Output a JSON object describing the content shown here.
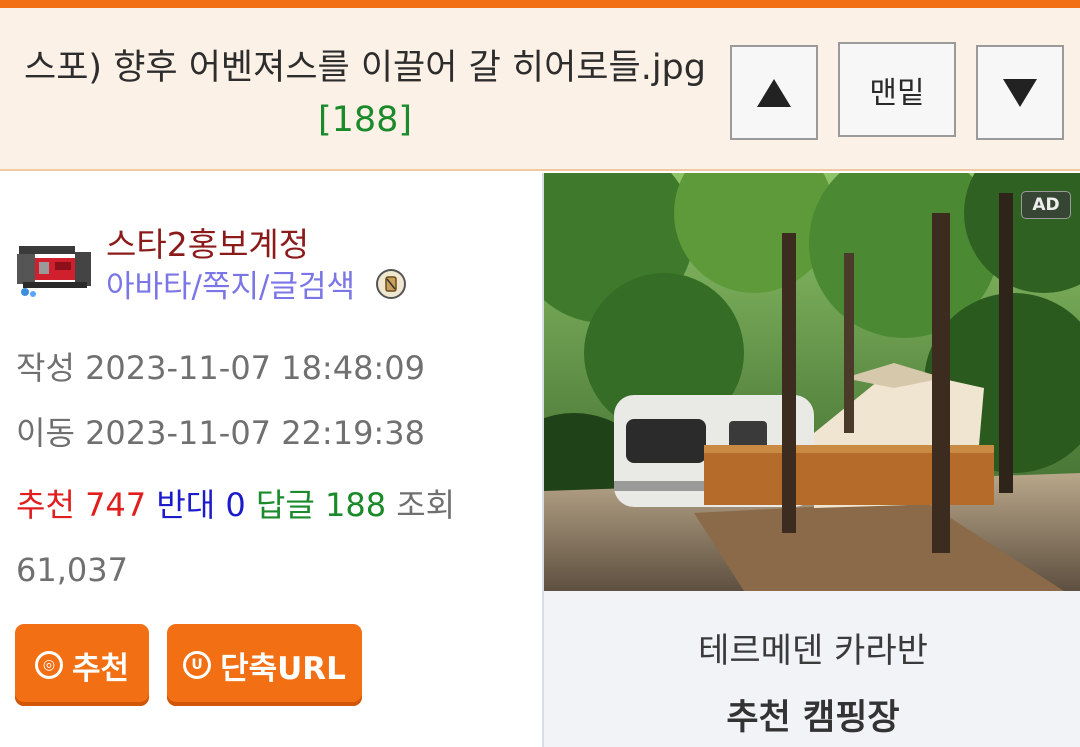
{
  "header": {
    "title": "스포) 향후 어벤져스를 이끌어 갈 히어로들.jpg",
    "comment_count": "[188]",
    "up_button": "up",
    "bottom_button_label": "맨밑",
    "down_button": "down"
  },
  "author": {
    "nickname": "스타2홍보계정",
    "links": "아바타/쪽지/글검색"
  },
  "meta": {
    "created_label": "작성",
    "created_value": "2023-11-07 18:48:09",
    "moved_label": "이동",
    "moved_value": "2023-11-07 22:19:38"
  },
  "stats": {
    "recommend_label": "추천",
    "recommend_value": "747",
    "oppose_label": "반대",
    "oppose_value": "0",
    "reply_label": "답글",
    "reply_value": "188",
    "view_label": "조회",
    "view_value": "61,037"
  },
  "actions": {
    "recommend_icon_glyph": "◎",
    "recommend_label": "추천",
    "short_url_icon_glyph": "U",
    "short_url_label": "단축URL"
  },
  "ad": {
    "tag": "AD",
    "caption": "테르메덴 카라반",
    "subcaption": "추천 캠핑장"
  },
  "colors": {
    "accent": "#f26f14",
    "header_bg": "#fcf1e6",
    "nickname": "#8b1b1b",
    "links": "#7b76e6",
    "recommend": "#e01e1e",
    "oppose": "#1b1bcc",
    "reply": "#1a8a2a"
  }
}
